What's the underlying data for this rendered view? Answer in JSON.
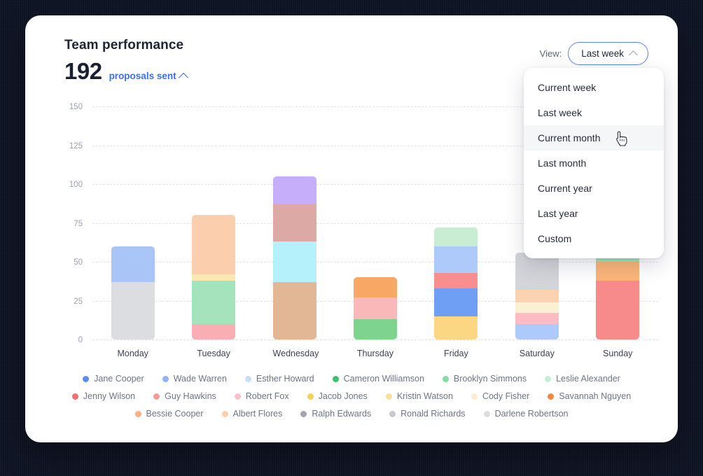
{
  "header": {
    "title": "Team performance",
    "metric_value": "192",
    "metric_label": "proposals sent",
    "view_label": "View:",
    "view_selected": "Last week"
  },
  "dropdown": {
    "items": [
      {
        "label": "Current week",
        "active": false
      },
      {
        "label": "Last week",
        "active": false
      },
      {
        "label": "Current month",
        "active": true
      },
      {
        "label": "Last month",
        "active": false
      },
      {
        "label": "Current year",
        "active": false
      },
      {
        "label": "Last year",
        "active": false
      },
      {
        "label": "Custom",
        "active": false
      }
    ]
  },
  "colors": {
    "accent_blue": "#3b6ef3",
    "card_bg": "#ffffff",
    "grid": "#e2e4ea",
    "axis_text": "#9aa1ae",
    "hover_bg": "#f5f6f8"
  },
  "chart_data": {
    "type": "bar",
    "stacked": true,
    "title": "Team performance",
    "xlabel": "",
    "ylabel": "",
    "ylim": [
      0,
      150
    ],
    "yticks": [
      0,
      25,
      50,
      75,
      100,
      125,
      150
    ],
    "grid": true,
    "legend_position": "bottom",
    "categories": [
      "Monday",
      "Tuesday",
      "Wednesday",
      "Thursday",
      "Friday",
      "Saturday",
      "Sunday"
    ],
    "totals": [
      60,
      80,
      105,
      40,
      72,
      56,
      66
    ],
    "series": [
      {
        "name": "Jane Cooper",
        "color": "#5b8def",
        "values": [
          0,
          0,
          0,
          0,
          18,
          0,
          0
        ]
      },
      {
        "name": "Wade Warren",
        "color": "#a9c5f7",
        "values": [
          23,
          0,
          0,
          0,
          17,
          10,
          0
        ]
      },
      {
        "name": "Esther Howard",
        "color": "#ccdcfb",
        "values": [
          0,
          0,
          0,
          0,
          0,
          0,
          0
        ]
      },
      {
        "name": "Cameron Williamson",
        "color": "#4cc47c",
        "values": [
          0,
          0,
          0,
          13,
          0,
          0,
          0
        ]
      },
      {
        "name": "Brooklyn Simmons",
        "color": "#a5e3bd",
        "values": [
          0,
          28,
          0,
          0,
          0,
          0,
          16
        ]
      },
      {
        "name": "Leslie Alexander",
        "color": "#cdf0da",
        "values": [
          0,
          0,
          0,
          0,
          12,
          0,
          0
        ]
      },
      {
        "name": "Jenny Wilson",
        "color": "#f78a8a",
        "values": [
          0,
          0,
          0,
          0,
          10,
          0,
          38
        ]
      },
      {
        "name": "Guy Hawkins",
        "color": "#f9a9a9",
        "values": [
          0,
          10,
          0,
          0,
          0,
          0,
          0
        ]
      },
      {
        "name": "Robert Fox",
        "color": "#fbc2ce",
        "values": [
          0,
          0,
          0,
          14,
          0,
          7,
          0
        ]
      },
      {
        "name": "Jacob Jones",
        "color": "#f6cf55",
        "values": [
          0,
          0,
          0,
          0,
          15,
          0,
          0
        ]
      },
      {
        "name": "Kristin Watson",
        "color": "#fbdf9a",
        "values": [
          0,
          4,
          0,
          0,
          0,
          0,
          0
        ]
      },
      {
        "name": "Cody Fisher",
        "color": "#fdf0d0",
        "values": [
          0,
          0,
          0,
          0,
          0,
          7,
          0
        ]
      },
      {
        "name": "Savannah Nguyen",
        "color": "#f79a5c",
        "values": [
          0,
          0,
          0,
          13,
          0,
          0,
          12
        ]
      },
      {
        "name": "Bessie Cooper",
        "color": "#f8b98a",
        "values": [
          0,
          0,
          0,
          0,
          0,
          8,
          0
        ]
      },
      {
        "name": "Albert Flores",
        "color": "#fbcfae",
        "values": [
          0,
          38,
          0,
          0,
          0,
          0,
          0
        ]
      },
      {
        "name": "Ralph Edwards",
        "color": "#9fa4ae",
        "values": [
          0,
          0,
          0,
          0,
          0,
          0,
          0
        ]
      },
      {
        "name": "Ronald Richards",
        "color": "#c5c8ce",
        "values": [
          0,
          0,
          0,
          0,
          0,
          24,
          0
        ]
      },
      {
        "name": "Darlene Robertson",
        "color": "#dcdde1",
        "values": [
          37,
          0,
          0,
          0,
          0,
          0,
          0
        ]
      }
    ],
    "stacks": [
      {
        "category": "Monday",
        "segments": [
          {
            "name": "Darlene Robertson",
            "value": 37,
            "color": "#dcdde1"
          },
          {
            "name": "Wade Warren",
            "value": 23,
            "color": "#a9c5f7"
          }
        ]
      },
      {
        "category": "Tuesday",
        "segments": [
          {
            "name": "Guy Hawkins",
            "value": 10,
            "color": "#f9aeb4"
          },
          {
            "name": "Brooklyn Simmons",
            "value": 28,
            "color": "#a5e3bd"
          },
          {
            "name": "Kristin Watson",
            "value": 4,
            "color": "#fbe7b2"
          },
          {
            "name": "Albert Flores",
            "value": 38,
            "color": "#fbcfae"
          }
        ]
      },
      {
        "category": "Wednesday",
        "segments": [
          {
            "name": "Bessie Cooper",
            "value": 37,
            "color": "#e2b795"
          },
          {
            "name": "Leslie Alexander",
            "value": 26,
            "color": "#b4f1fb"
          },
          {
            "name": "Guy Hawkins",
            "value": 24,
            "color": "#dda9a4"
          },
          {
            "name": "Jane Cooper",
            "value": 18,
            "color": "#c6aefb"
          }
        ]
      },
      {
        "category": "Thursday",
        "segments": [
          {
            "name": "Cameron Williamson",
            "value": 13,
            "color": "#7ed48f"
          },
          {
            "name": "Robert Fox",
            "value": 14,
            "color": "#fbb8b8"
          },
          {
            "name": "Savannah Nguyen",
            "value": 13,
            "color": "#f9a765"
          }
        ]
      },
      {
        "category": "Friday",
        "segments": [
          {
            "name": "Jacob Jones",
            "value": 15,
            "color": "#fcd783"
          },
          {
            "name": "Jane Cooper",
            "value": 18,
            "color": "#6f9ef5"
          },
          {
            "name": "Jenny Wilson",
            "value": 10,
            "color": "#f98e8e"
          },
          {
            "name": "Esther Howard",
            "value": 17,
            "color": "#aecafb"
          },
          {
            "name": "Leslie Alexander",
            "value": 12,
            "color": "#c9edd2"
          }
        ]
      },
      {
        "category": "Saturday",
        "segments": [
          {
            "name": "Wade Warren",
            "value": 10,
            "color": "#aecafb"
          },
          {
            "name": "Robert Fox",
            "value": 7,
            "color": "#fbbcc3"
          },
          {
            "name": "Cody Fisher",
            "value": 7,
            "color": "#fcf0d4"
          },
          {
            "name": "Bessie Cooper",
            "value": 8,
            "color": "#fbd3b2"
          },
          {
            "name": "Ronald Richards",
            "value": 24,
            "color": "#d3d5da"
          }
        ]
      },
      {
        "category": "Sunday",
        "segments": [
          {
            "name": "Jenny Wilson",
            "value": 38,
            "color": "#f78a8a"
          },
          {
            "name": "Savannah Nguyen",
            "value": 12,
            "color": "#fcb67a"
          },
          {
            "name": "Brooklyn Simmons",
            "value": 16,
            "color": "#a5e3bd"
          }
        ]
      }
    ],
    "legend": [
      [
        {
          "name": "Jane Cooper",
          "color": "#5b8def"
        },
        {
          "name": "Wade Warren",
          "color": "#8fb4f6"
        },
        {
          "name": "Esther Howard",
          "color": "#ccdcfb"
        },
        {
          "name": "Cameron Williamson",
          "color": "#3cc071"
        },
        {
          "name": "Brooklyn Simmons",
          "color": "#86dca6"
        },
        {
          "name": "Leslie Alexander",
          "color": "#c6eed6"
        }
      ],
      [
        {
          "name": "Jenny Wilson",
          "color": "#f4706f"
        },
        {
          "name": "Guy Hawkins",
          "color": "#f89a9a"
        },
        {
          "name": "Robert Fox",
          "color": "#fbc0c9"
        },
        {
          "name": "Jacob Jones",
          "color": "#f6cf55"
        },
        {
          "name": "Kristin Watson",
          "color": "#fbdf9a"
        },
        {
          "name": "Cody Fisher",
          "color": "#fdedcf"
        },
        {
          "name": "Savannah Nguyen",
          "color": "#f5873f"
        }
      ],
      [
        {
          "name": "Bessie Cooper",
          "color": "#f9b183"
        },
        {
          "name": "Albert Flores",
          "color": "#fbcfae"
        },
        {
          "name": "Ralph Edwards",
          "color": "#9fa4ae"
        },
        {
          "name": "Ronald Richards",
          "color": "#c5c8ce"
        },
        {
          "name": "Darlene Robertson",
          "color": "#dcdde1"
        }
      ]
    ]
  }
}
